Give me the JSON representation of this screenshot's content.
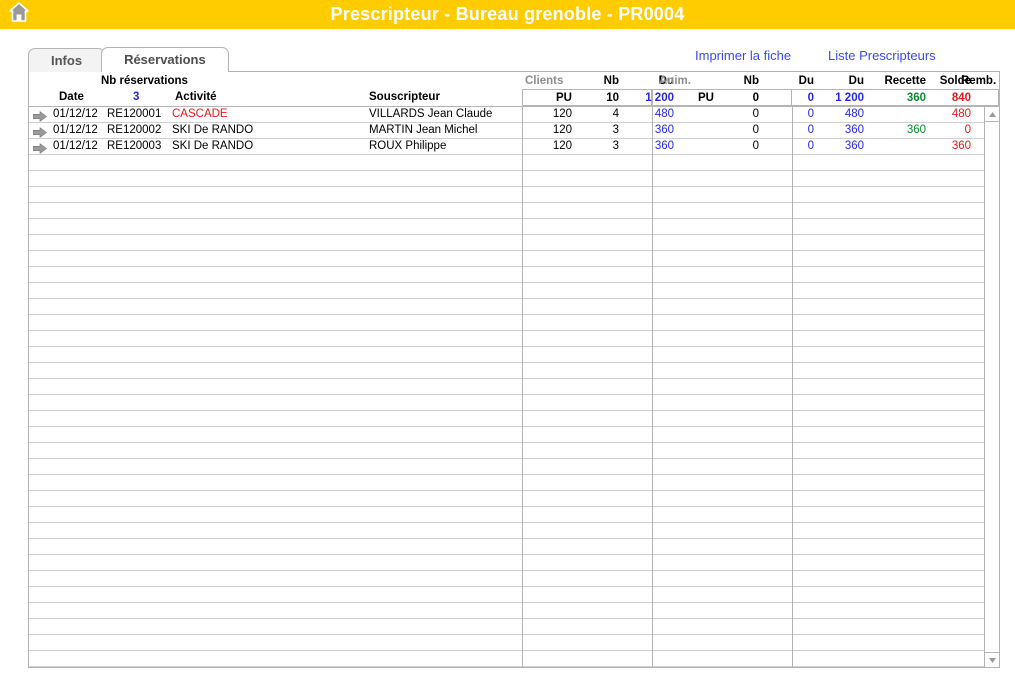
{
  "titlebar": {
    "title": "Prescripteur - Bureau grenoble - PR0004",
    "home_icon": "home-icon",
    "bg_color": "#ffcc00",
    "title_color": "#ffffff"
  },
  "tabs": [
    {
      "label": "Infos",
      "active": false
    },
    {
      "label": "Réservations",
      "active": true
    }
  ],
  "links": {
    "print": "Imprimer la fiche",
    "list": "Liste Prescripteurs",
    "color": "#3b47f5"
  },
  "table": {
    "group_headers": {
      "nb_reservations": "Nb réservations",
      "clients": "Clients",
      "anim": "Anim."
    },
    "columns": [
      "Date",
      "3",
      "Activité",
      "Souscripteur",
      "PU",
      "Nb",
      "Du",
      "PU",
      "Nb",
      "Du",
      "Du",
      "Recette",
      "Solde",
      "Remb."
    ],
    "summary": {
      "clients_pu": "PU",
      "clients_nb": "10",
      "clients_du": "1 200",
      "anim_pu": "PU",
      "anim_nb": "0",
      "anim_du": "0",
      "total_du": "1 200",
      "recette": "360",
      "solde": "840",
      "remb": ""
    },
    "rows": [
      {
        "arrow": "arrow-right-icon",
        "date": "01/12/12",
        "ref": "RE120001",
        "activite": "CASCADE",
        "activite_color": "#e01b1b",
        "souscripteur": "VILLARDS Jean Claude",
        "clients_pu": "120",
        "clients_nb": "4",
        "clients_du": "480",
        "anim_pu": "",
        "anim_nb": "0",
        "anim_du": "0",
        "total_du": "480",
        "recette": "",
        "solde": "480",
        "remb": ""
      },
      {
        "arrow": "arrow-right-icon",
        "date": "01/12/12",
        "ref": "RE120002",
        "activite": "SKI De RANDO",
        "activite_color": "#000000",
        "souscripteur": "MARTIN Jean Michel",
        "clients_pu": "120",
        "clients_nb": "3",
        "clients_du": "360",
        "anim_pu": "",
        "anim_nb": "0",
        "anim_du": "0",
        "total_du": "360",
        "recette": "360",
        "solde": "0",
        "remb": ""
      },
      {
        "arrow": "arrow-right-icon",
        "date": "01/12/12",
        "ref": "RE120003",
        "activite": "SKI De RANDO",
        "activite_color": "#000000",
        "souscripteur": "ROUX Philippe",
        "clients_pu": "120",
        "clients_nb": "3",
        "clients_du": "360",
        "anim_pu": "",
        "anim_nb": "0",
        "anim_du": "0",
        "total_du": "360",
        "recette": "",
        "solde": "360",
        "remb": ""
      }
    ],
    "empty_row_count": 32
  },
  "scrollbar": {
    "up_icon": "scroll-up-arrow-icon",
    "down_icon": "scroll-down-arrow-icon"
  },
  "colors": {
    "accent_yellow": "#ffcc00",
    "link_blue": "#3b47f5",
    "value_blue": "#2626e0",
    "value_red": "#e01b1b",
    "value_green": "#0a8a2e",
    "border_gray": "#b4b4b4"
  }
}
